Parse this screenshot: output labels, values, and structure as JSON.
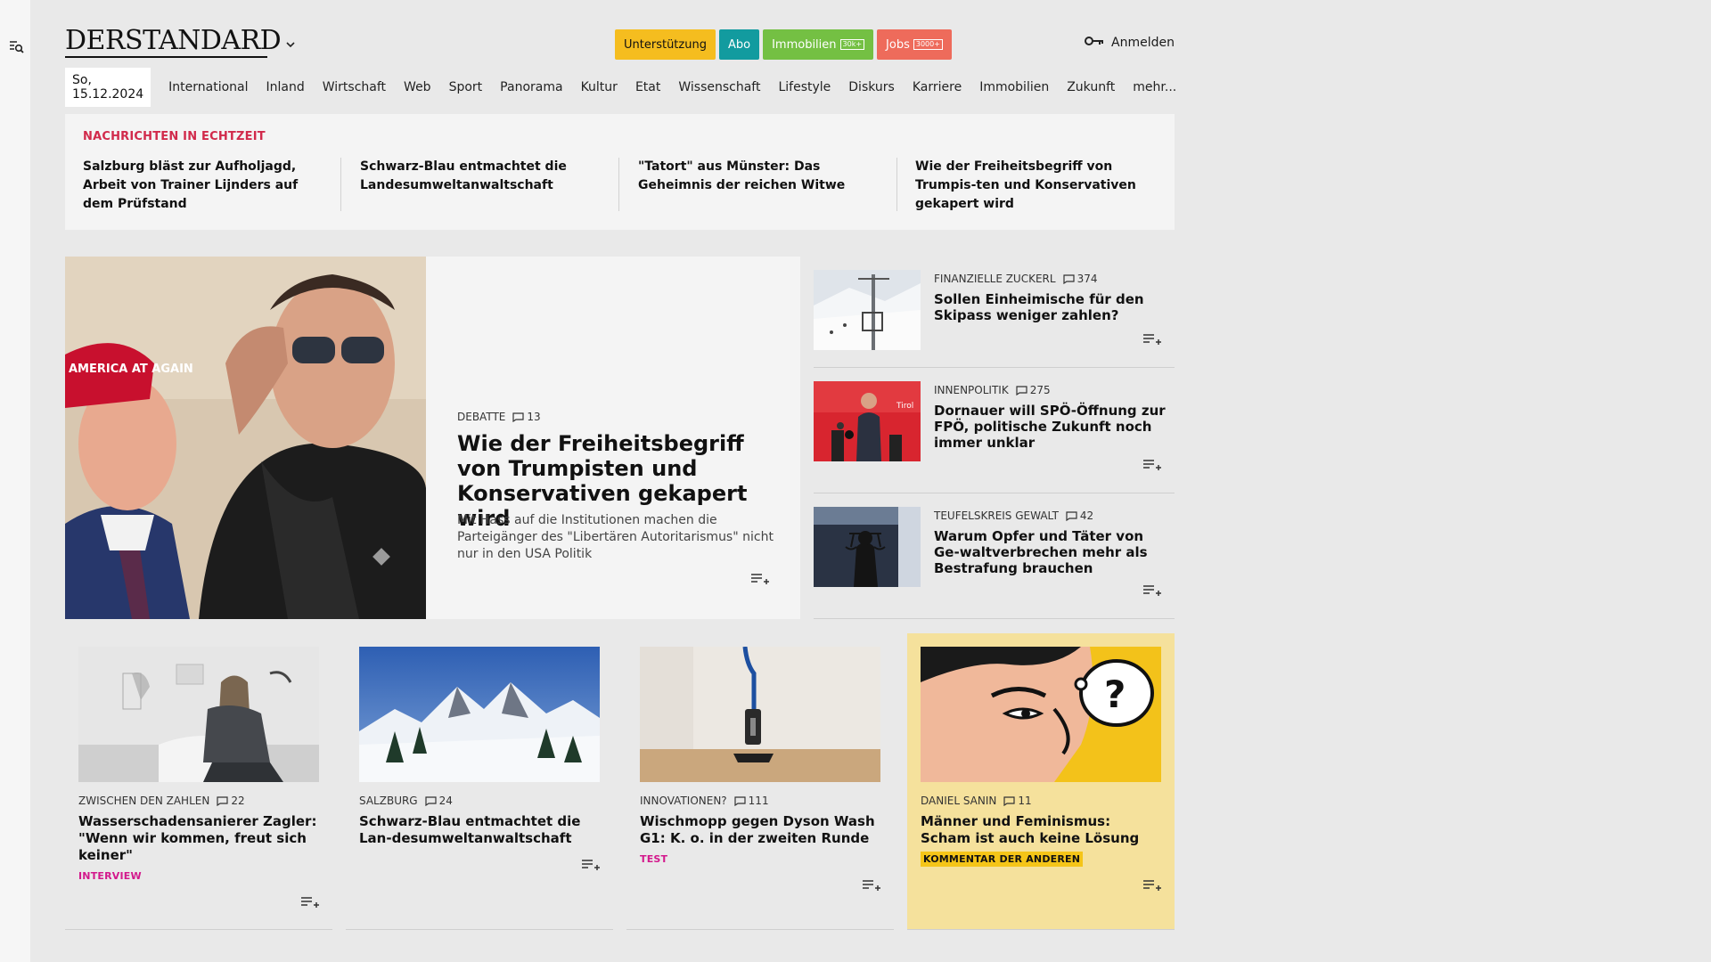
{
  "site": {
    "logo": "DERSTANDARD",
    "promo": {
      "support": "Unterstützung",
      "abo": "Abo",
      "immobilien": "Immobilien",
      "immobilien_badge": "30k+",
      "jobs": "Jobs",
      "jobs_badge": "3000+"
    },
    "login": "Anmelden"
  },
  "nav": {
    "date": "So, 15.12.2024",
    "items": [
      "International",
      "Inland",
      "Wirtschaft",
      "Web",
      "Sport",
      "Panorama",
      "Kultur",
      "Etat",
      "Wissenschaft",
      "Lifestyle",
      "Diskurs",
      "Karriere",
      "Immobilien",
      "Zukunft",
      "mehr..."
    ]
  },
  "ticker": {
    "label": "NACHRICHTEN IN ECHTZEIT",
    "items": [
      "Salzburg bläst zur Aufholjagd, Arbeit von Trainer Lijnders auf dem Prüfstand",
      "Schwarz-Blau entmachtet die Landesumweltanwaltschaft",
      "\"Tatort\" aus Münster: Das Geheimnis der reichen Witwe",
      "Wie der Freiheitsbegriff von Trumpis-ten und Konservativen gekapert wird"
    ]
  },
  "hero": {
    "kicker": "DEBATTE",
    "comments": "13",
    "title": "Wie der Freiheitsbegriff von Trumpisten und Konservativen gekapert wird",
    "lead": "Mit Hass auf die Institutionen machen die Parteigänger des \"Libertären Autoritarismus\" nicht nur in den USA Politik",
    "image_text": "AMERICA AT AGAIN"
  },
  "side": [
    {
      "kicker": "FINANZIELLE ZUCKERL",
      "comments": "374",
      "title": "Sollen Einheimische für den Skipass weniger zahlen?"
    },
    {
      "kicker": "INNENPOLITIK",
      "comments": "275",
      "title": "Dornauer will SPÖ-Öffnung zur FPÖ, politische Zukunft noch immer unklar",
      "image_text": "Tirol"
    },
    {
      "kicker": "TEUFELSKREIS GEWALT",
      "comments": "42",
      "title": "Warum Opfer und Täter von Ge-waltverbrechen mehr als Bestrafung brauchen"
    }
  ],
  "cards": [
    {
      "kicker": "ZWISCHEN DEN ZAHLEN",
      "comments": "22",
      "title": "Wasserschadensanierer Zagler: \"Wenn wir kommen, freut sich keiner\"",
      "tag": "INTERVIEW"
    },
    {
      "kicker": "SALZBURG",
      "comments": "24",
      "title": "Schwarz-Blau entmachtet die Lan-desumweltanwaltschaft",
      "tag": ""
    },
    {
      "kicker": "INNOVATIONEN?",
      "comments": "111",
      "title": "Wischmopp gegen Dyson Wash G1: K. o. in der zweiten Runde",
      "tag": "TEST"
    },
    {
      "kicker": "DANIEL SANIN",
      "comments": "11",
      "title": "Männer und Feminismus: Scham ist auch keine Lösung",
      "tag": "KOMMENTAR DER ANDEREN"
    }
  ],
  "colors": {
    "background": "#e9e9e9",
    "ticker_label": "#d12a4b",
    "tag_pink": "#d3188c",
    "opinion_bg": "#f5e19c",
    "opinion_tag": "#f5c518"
  }
}
